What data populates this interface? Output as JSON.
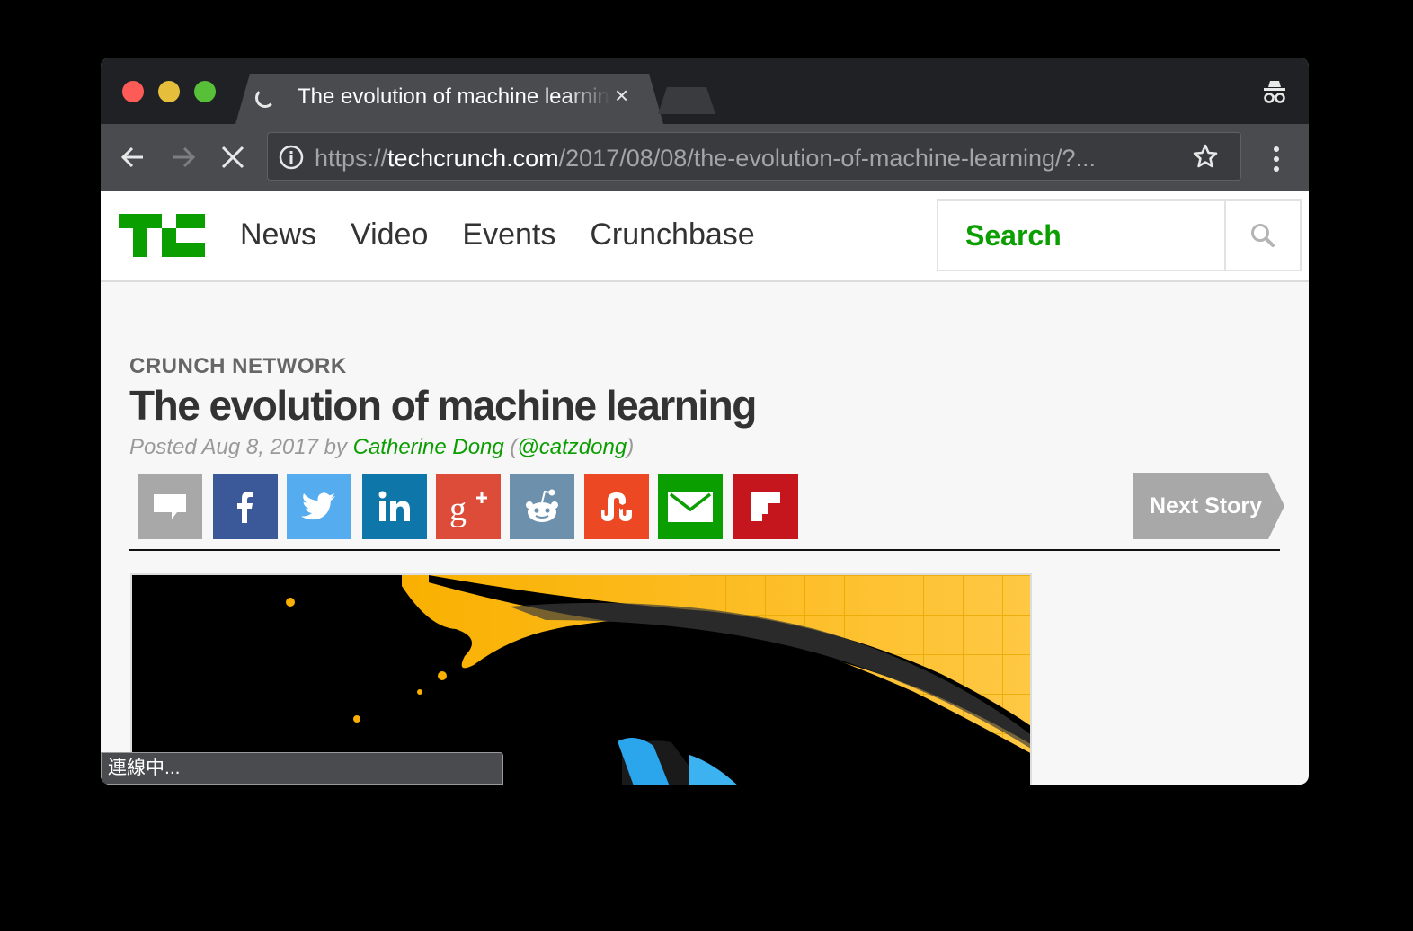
{
  "browser": {
    "tab_title": "The evolution of machine learning",
    "tab_close": "×",
    "url_scheme": "https://",
    "url_host": "techcrunch.com",
    "url_path": "/2017/08/08/the-evolution-of-machine-learning/?...",
    "status_text": "連線中..."
  },
  "site": {
    "nav": [
      "News",
      "Video",
      "Events",
      "Crunchbase"
    ],
    "search_placeholder": "Search",
    "brand_color": "#0a9e01"
  },
  "article": {
    "kicker": "CRUNCH NETWORK",
    "title": "The evolution of machine learning",
    "byline_prefix": "Posted Aug 8, 2017 by ",
    "author": "Catherine Dong",
    "handle_open": " (",
    "handle": "@catzdong",
    "handle_close": ")",
    "next_story": "Next Story"
  },
  "share_buttons": [
    {
      "icon": "comment-icon",
      "color": "#a8a8a8"
    },
    {
      "icon": "facebook-icon",
      "color": "#3b5998"
    },
    {
      "icon": "twitter-icon",
      "color": "#55acee"
    },
    {
      "icon": "linkedin-icon",
      "color": "#0e76a8"
    },
    {
      "icon": "google-plus-icon",
      "color": "#dd4b39"
    },
    {
      "icon": "reddit-icon",
      "color": "#6d91ad"
    },
    {
      "icon": "stumbleupon-icon",
      "color": "#eb4823"
    },
    {
      "icon": "email-icon",
      "color": "#0a9e01"
    },
    {
      "icon": "flipboard-icon",
      "color": "#c4161c"
    }
  ]
}
